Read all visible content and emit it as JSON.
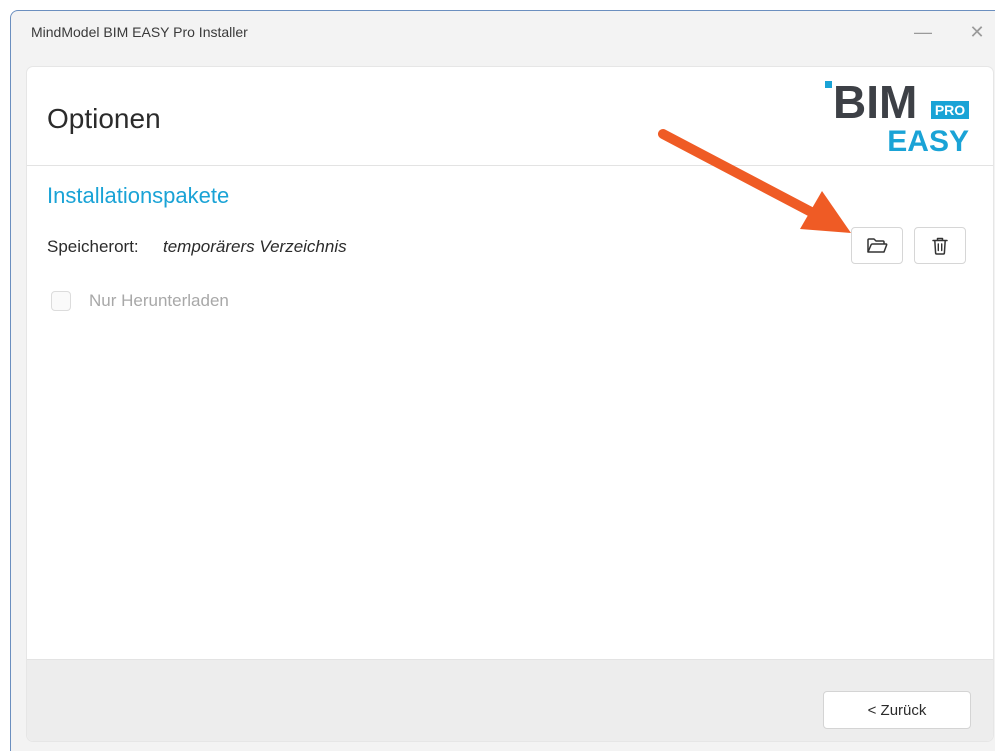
{
  "window": {
    "title": "MindModel BIM EASY Pro Installer",
    "minimize_glyph": "—",
    "close_glyph": "✕"
  },
  "header": {
    "title": "Optionen",
    "logo": {
      "main": "BIM",
      "badge": "PRO",
      "sub": "EASY"
    }
  },
  "section": {
    "title": "Installationspakete",
    "location_label": "Speicherort:",
    "location_value": "temporärers Verzeichnis",
    "buttons": [
      {
        "name": "browse-folder-button",
        "icon": "folder-open-icon"
      },
      {
        "name": "delete-button",
        "icon": "trash-icon"
      }
    ]
  },
  "options": {
    "download_only_label": "Nur Herunterladen",
    "download_only_checked": false,
    "download_only_enabled": false
  },
  "footer": {
    "back_label": "< Zurück"
  },
  "colors": {
    "accent": "#1aa3d6",
    "logo_dark": "#3d4046",
    "annotation_arrow": "#ef5b25"
  }
}
